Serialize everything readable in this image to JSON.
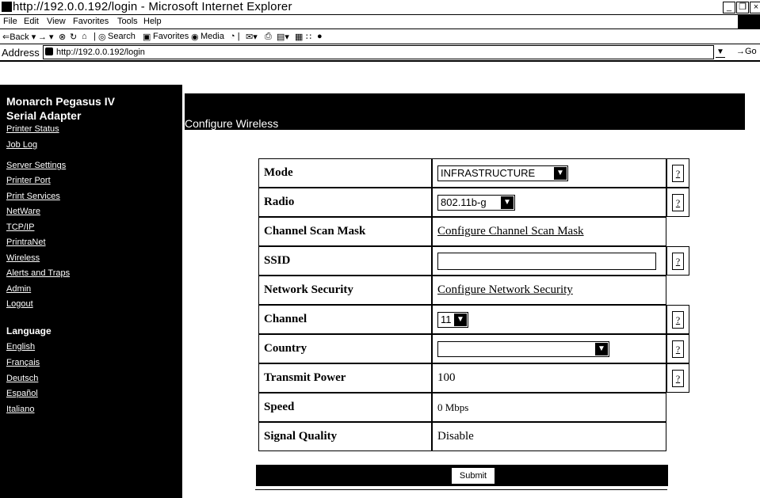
{
  "window": {
    "title": "http://192.0.0.192/login - Microsoft Internet Explorer",
    "controls": [
      "_",
      "❐",
      "×"
    ]
  },
  "menu": [
    "File",
    "Edit",
    "View",
    "Favorites",
    "Tools",
    "Help"
  ],
  "toolbar": {
    "back": "⇐Back ▾",
    "forward": "→ ▾",
    "search": "Search",
    "favorites": "Favorites",
    "media": "Media"
  },
  "address": {
    "label": "Address",
    "url": "http://192.0.0.192/login",
    "go": "Go"
  },
  "sidebar": {
    "brand_line1": "Monarch Pegasus IV",
    "brand_line2": "Serial Adapter",
    "links": [
      "Printer Status",
      "Job Log",
      "Server Settings",
      "Printer Port",
      "Print Services",
      "NetWare",
      "TCP/IP",
      "PrintraNet",
      "Wireless",
      "Alerts and Traps",
      "Admin",
      "Logout"
    ],
    "language_heading": "Language",
    "languages": [
      "English",
      "Français",
      "Deutsch",
      "Español",
      "Italiano"
    ]
  },
  "main": {
    "heading": "Configure Wireless",
    "rows": {
      "mode": {
        "label": "Mode",
        "value": "INFRASTRUCTURE"
      },
      "radio": {
        "label": "Radio",
        "value": "802.11b-g"
      },
      "scan": {
        "label": "Channel Scan Mask",
        "link": "Configure Channel Scan Mask"
      },
      "ssid": {
        "label": "SSID",
        "value": ""
      },
      "security": {
        "label": "Network Security",
        "link": "Configure Network Security"
      },
      "channel": {
        "label": "Channel",
        "value": "11"
      },
      "country": {
        "label": "Country",
        "value": ""
      },
      "power": {
        "label": "Transmit Power",
        "value": "100"
      },
      "speed": {
        "label": "Speed",
        "value": "0 Mbps"
      },
      "signal": {
        "label": "Signal Quality",
        "value": "Disable"
      }
    },
    "help_label": "?",
    "submit": "Submit"
  }
}
